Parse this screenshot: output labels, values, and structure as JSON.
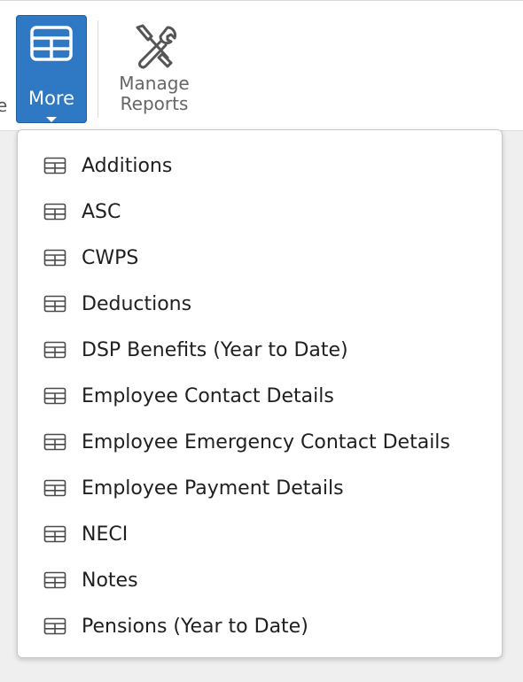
{
  "toolbar": {
    "partial_label": "e",
    "more_button": {
      "label": "More",
      "icon": "table-icon"
    },
    "manage_reports_button": {
      "label_line1": "Manage",
      "label_line2": "Reports",
      "icon": "tools-icon"
    }
  },
  "menu": {
    "items": [
      {
        "label": "Additions",
        "icon": "table-icon"
      },
      {
        "label": "ASC",
        "icon": "table-icon"
      },
      {
        "label": "CWPS",
        "icon": "table-icon"
      },
      {
        "label": "Deductions",
        "icon": "table-icon"
      },
      {
        "label": "DSP Benefits (Year to Date)",
        "icon": "table-icon"
      },
      {
        "label": "Employee Contact Details",
        "icon": "table-icon"
      },
      {
        "label": "Employee Emergency Contact Details",
        "icon": "table-icon"
      },
      {
        "label": "Employee Payment Details",
        "icon": "table-icon"
      },
      {
        "label": "NECI",
        "icon": "table-icon"
      },
      {
        "label": "Notes",
        "icon": "table-icon"
      },
      {
        "label": "Pensions (Year to Date)",
        "icon": "table-icon"
      }
    ]
  },
  "colors": {
    "accent": "#2f78c4",
    "menu_text": "#1f1f1f",
    "muted_text": "#666666"
  }
}
